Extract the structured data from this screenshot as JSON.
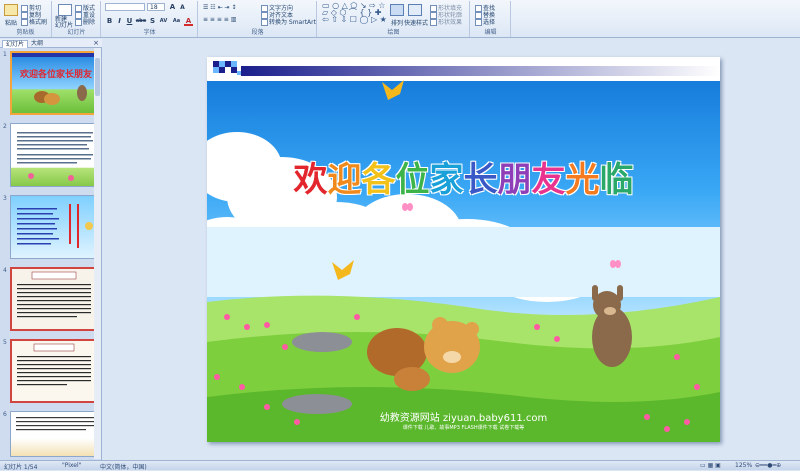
{
  "ribbon": {
    "clipboard": {
      "paste_label": "粘贴",
      "cut_label": "剪切",
      "copy_label": "复制",
      "format_painter_label": "格式刷",
      "group_label": "剪贴板"
    },
    "slides": {
      "new_slide_label": "新建\n幻灯片",
      "layout_label": "版式",
      "reset_label": "重设",
      "delete_label": "删除",
      "group_label": "幻灯片"
    },
    "font": {
      "font_name": "",
      "font_size": "18",
      "bold": "B",
      "italic": "I",
      "underline": "U",
      "strike": "abe",
      "shadow": "S",
      "spacing": "AV",
      "case": "Aa",
      "color": "A",
      "group_label": "字体"
    },
    "paragraph": {
      "text_direction_label": "文字方向",
      "align_text_label": "对齐文本",
      "smartart_label": "转换为 SmartArt",
      "group_label": "段落"
    },
    "drawing": {
      "arrange_label": "排列",
      "quick_styles_label": "快速样式",
      "shape_fill_label": "形状填充",
      "shape_outline_label": "形状轮廓",
      "shape_effects_label": "形状效果",
      "group_label": "绘图"
    },
    "editing": {
      "find_label": "查找",
      "replace_label": "替换",
      "select_label": "选择",
      "group_label": "编辑"
    }
  },
  "panel": {
    "tab_slides": "幻灯片",
    "tab_outline": "大纲",
    "close_glyph": "×",
    "thumb_numbers": [
      "1",
      "2",
      "3",
      "4",
      "5",
      "6"
    ]
  },
  "slide": {
    "title_chars": [
      "欢",
      "迎",
      "各",
      "位",
      "家",
      "长",
      "朋",
      "友",
      "光",
      "临"
    ],
    "footer_main": "幼教资源网站  ziyuan.baby611.com",
    "footer_sub": "课件下载    儿歌、故事MP3    FLASH课件下载    试卷下载等"
  },
  "status": {
    "slide_counter": "幻灯片 1/54",
    "theme": "\"Pixel\"",
    "language": "中文(简体，中国)",
    "zoom": "125%"
  },
  "colors": {
    "title_palette": [
      "#e3262d",
      "#f08a1c",
      "#f3d41a",
      "#3cb44a",
      "#1aa0d8",
      "#3b59c6",
      "#8e3fb8",
      "#e8348f",
      "#f47b20",
      "#2aa86a"
    ],
    "selection_border": "#f3a43b"
  }
}
